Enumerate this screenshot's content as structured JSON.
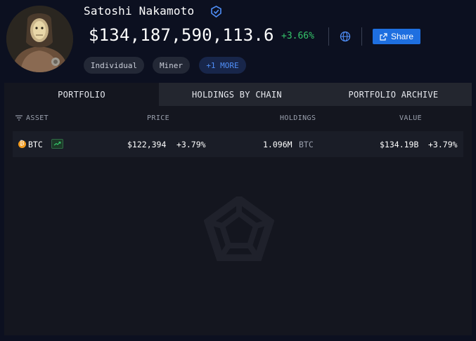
{
  "profile": {
    "name": "Satoshi Nakamoto",
    "balance": "$134,187,590,113.6",
    "balance_change": "+3.66%",
    "share_label": "Share",
    "tags": [
      "Individual",
      "Miner",
      "+1 MORE"
    ]
  },
  "tabs": [
    "PORTFOLIO",
    "HOLDINGS BY CHAIN",
    "PORTFOLIO ARCHIVE"
  ],
  "table": {
    "headers": [
      "ASSET",
      "PRICE",
      "HOLDINGS",
      "VALUE"
    ],
    "rows": [
      {
        "asset": "BTC",
        "price": "$122,394",
        "price_change": "+3.79%",
        "holdings": "1.096M",
        "holdings_unit": "BTC",
        "value": "$134.19B",
        "value_change": "+3.79%"
      }
    ]
  },
  "icons": {
    "verified": "verified-badge-icon",
    "globe": "globe-icon",
    "share": "external-share-icon",
    "filter": "filter-lines-icon",
    "asset": "bitcoin-icon",
    "trend": "trend-up-icon",
    "watermark": "arkham-logo-icon"
  },
  "colors": {
    "background": "#0c1020",
    "panel": "#14161f",
    "accent": "#1e6fe0",
    "positive": "#35c56a",
    "btc": "#f39c1f"
  }
}
